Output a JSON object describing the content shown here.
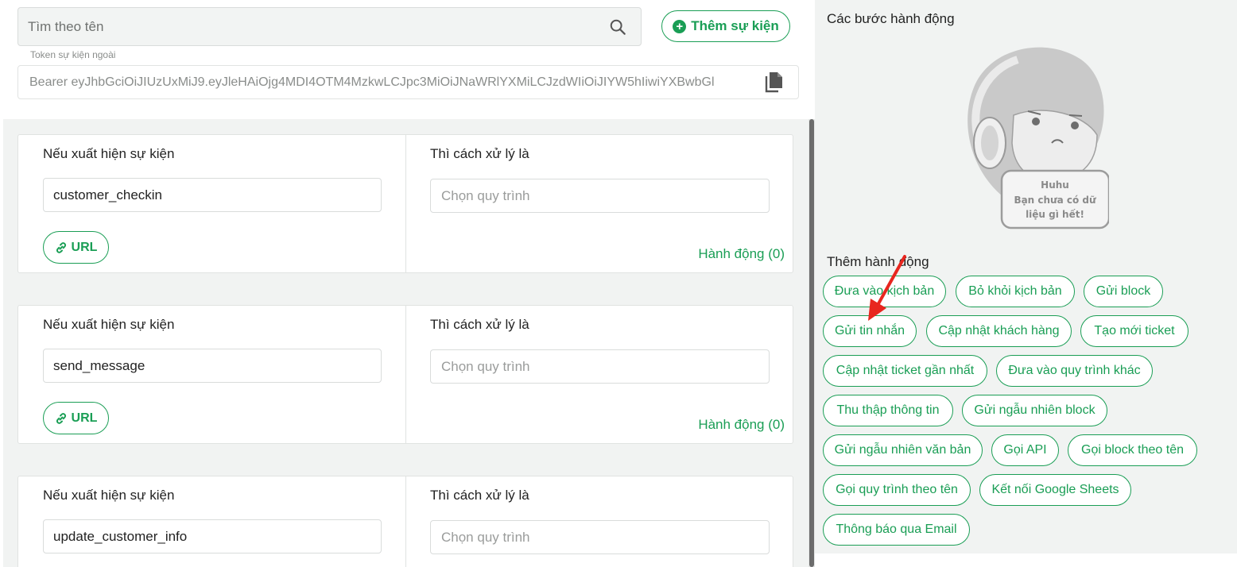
{
  "search": {
    "placeholder": "Tìm theo tên"
  },
  "add_event_button": "Thêm sự kiện",
  "token": {
    "label": "Token sự kiện ngoài",
    "value": "Bearer eyJhbGciOiJIUzUxMiJ9.eyJleHAiOjg4MDI4OTM4MzkwLCJpc3MiOiJNaWRlYXMiLCJzdWIiOiJIYW5hIiwiYXBwbGl"
  },
  "events": [
    {
      "condition_label": "Nếu xuất hiện sự kiện",
      "event_name": "customer_checkin",
      "then_label": "Thì cách xử lý là",
      "flow_placeholder": "Chọn quy trình",
      "url_label": "URL",
      "action_count": "Hành động (0)"
    },
    {
      "condition_label": "Nếu xuất hiện sự kiện",
      "event_name": "send_message",
      "then_label": "Thì cách xử lý là",
      "flow_placeholder": "Chọn quy trình",
      "url_label": "URL",
      "action_count": "Hành động (0)"
    },
    {
      "condition_label": "Nếu xuất hiện sự kiện",
      "event_name": "update_customer_info",
      "then_label": "Thì cách xử lý là",
      "flow_placeholder": "Chọn quy trình"
    }
  ],
  "right_panel": {
    "steps_title": "Các bước hành động",
    "empty_state": {
      "top": "Huhu",
      "line1": "Bạn chưa có dữ",
      "line2": "liệu gì hết!"
    },
    "add_action_title": "Thêm hành động",
    "actions": [
      "Đưa vào kịch bản",
      "Bỏ khỏi kịch bản",
      "Gửi block",
      "Gửi tin nhắn",
      "Cập nhật khách hàng",
      "Tạo mới ticket",
      "Cập nhật ticket gần nhất",
      "Đưa vào quy trình khác",
      "Thu thập thông tin",
      "Gửi ngẫu nhiên block",
      "Gửi ngẫu nhiên văn bản",
      "Gọi API",
      "Gọi block theo tên",
      "Gọi quy trình theo tên",
      "Kết nối Google Sheets",
      "Thông báo qua Email"
    ]
  },
  "colors": {
    "accent": "#1a9e55",
    "panel_bg": "#f1f3f2",
    "annotation_arrow": "#e8261f"
  }
}
